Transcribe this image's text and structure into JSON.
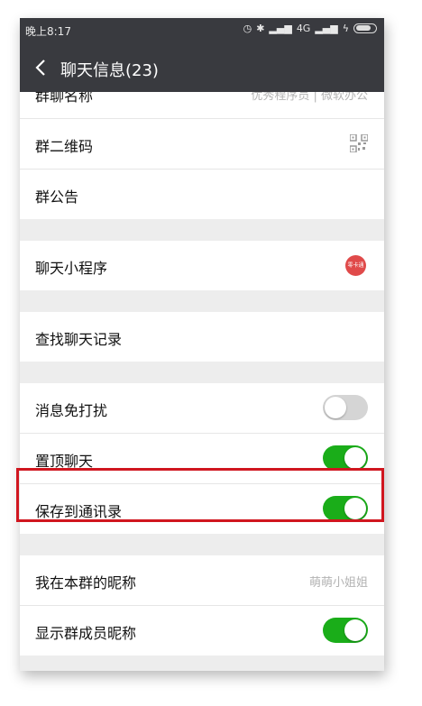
{
  "status": {
    "time": "晚上8:17",
    "network": "4G"
  },
  "header": {
    "title": "聊天信息(23)"
  },
  "groups": {
    "group1": {
      "name_label": "群聊名称",
      "name_value": "优秀程序员 | 微软办公",
      "qrcode_label": "群二维码",
      "notice_label": "群公告"
    },
    "group2": {
      "miniprogram_label": "聊天小程序",
      "miniprogram_icon_text": "零卡通"
    },
    "group3": {
      "search_label": "查找聊天记录"
    },
    "group4": {
      "mute_label": "消息免打扰",
      "mute_on": false,
      "pin_label": "置顶聊天",
      "pin_on": true,
      "save_label": "保存到通讯录",
      "save_on": true
    },
    "group5": {
      "nickname_label": "我在本群的昵称",
      "nickname_value": "萌萌小姐姐",
      "show_nick_label": "显示群成员昵称",
      "show_nick_on": true
    }
  },
  "colors": {
    "toggle_on": "#1aad19",
    "toggle_off": "#d5d5d5",
    "highlight": "#d0161f",
    "header_bg": "#393a3f"
  }
}
